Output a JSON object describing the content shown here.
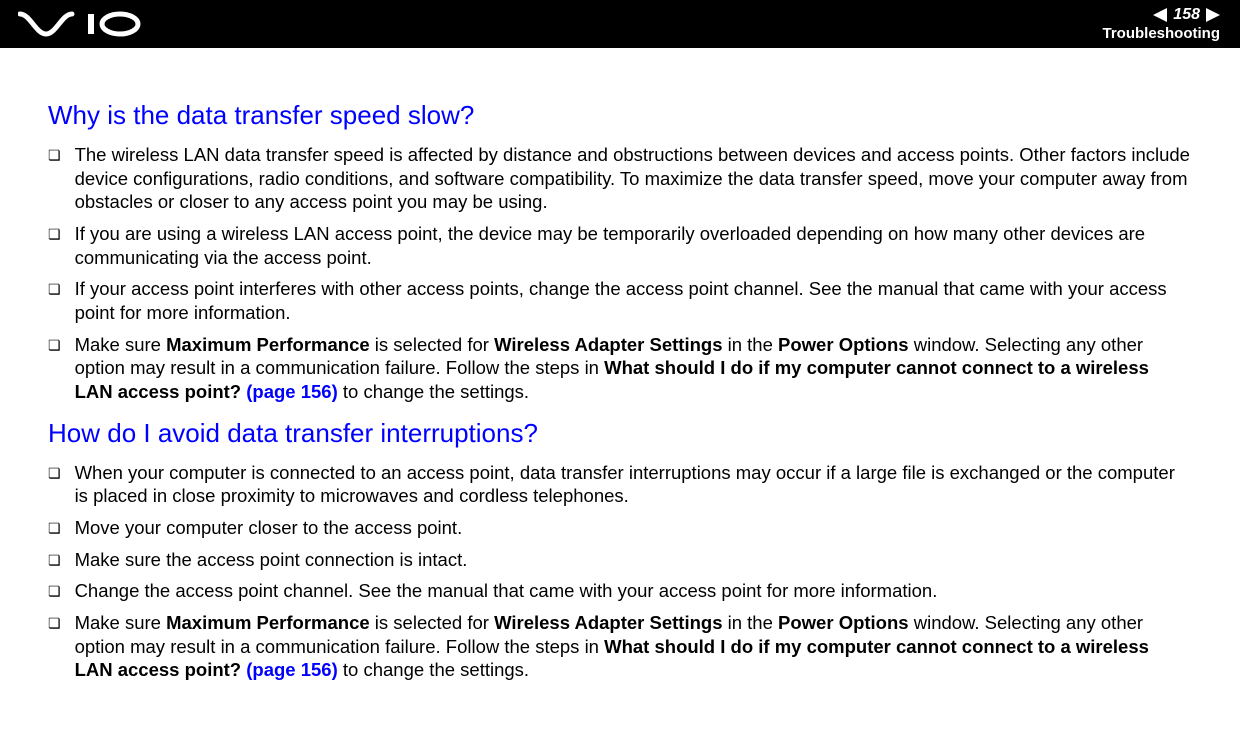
{
  "header": {
    "page_number": "158",
    "section": "Troubleshooting"
  },
  "sections": [
    {
      "heading": "Why is the data transfer speed slow?",
      "items": [
        {
          "runs": [
            {
              "t": "The wireless LAN data transfer speed is affected by distance and obstructions between devices and access points. Other factors include device configurations, radio conditions, and software compatibility. To maximize the data transfer speed, move your computer away from obstacles or closer to any access point you may be using."
            }
          ]
        },
        {
          "runs": [
            {
              "t": "If you are using a wireless LAN access point, the device may be temporarily overloaded depending on how many other devices are communicating via the access point."
            }
          ]
        },
        {
          "runs": [
            {
              "t": "If your access point interferes with other access points, change the access point channel. See the manual that came with your access point for more information."
            }
          ]
        },
        {
          "runs": [
            {
              "t": "Make sure "
            },
            {
              "t": "Maximum Performance",
              "bold": true
            },
            {
              "t": " is selected for "
            },
            {
              "t": "Wireless Adapter Settings",
              "bold": true
            },
            {
              "t": " in the "
            },
            {
              "t": "Power Options",
              "bold": true
            },
            {
              "t": " window. Selecting any other option may result in a communication failure. Follow the steps in "
            },
            {
              "t": "What should I do if my computer cannot connect to a wireless LAN access point?",
              "bold": true
            },
            {
              "t": " "
            },
            {
              "t": "(page 156)",
              "link": true
            },
            {
              "t": " to change the settings."
            }
          ]
        }
      ]
    },
    {
      "heading": "How do I avoid data transfer interruptions?",
      "items": [
        {
          "runs": [
            {
              "t": "When your computer is connected to an access point, data transfer interruptions may occur if a large file is exchanged or the computer is placed in close proximity to microwaves and cordless telephones."
            }
          ]
        },
        {
          "runs": [
            {
              "t": "Move your computer closer to the access point."
            }
          ]
        },
        {
          "runs": [
            {
              "t": "Make sure the access point connection is intact."
            }
          ]
        },
        {
          "runs": [
            {
              "t": "Change the access point channel. See the manual that came with your access point for more information."
            }
          ]
        },
        {
          "runs": [
            {
              "t": "Make sure "
            },
            {
              "t": "Maximum Performance",
              "bold": true
            },
            {
              "t": " is selected for "
            },
            {
              "t": "Wireless Adapter Settings",
              "bold": true
            },
            {
              "t": " in the "
            },
            {
              "t": "Power Options",
              "bold": true
            },
            {
              "t": " window. Selecting any other option may result in a communication failure. Follow the steps in "
            },
            {
              "t": "What should I do if my computer cannot connect to a wireless LAN access point?",
              "bold": true
            },
            {
              "t": " "
            },
            {
              "t": "(page 156)",
              "link": true
            },
            {
              "t": " to change the settings."
            }
          ]
        }
      ]
    }
  ]
}
